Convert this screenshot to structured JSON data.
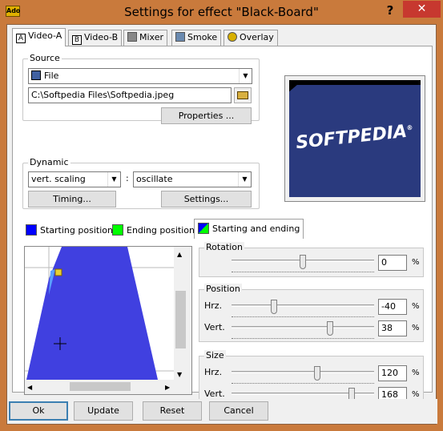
{
  "window": {
    "title": "Settings for effect \"Black-Board\"",
    "app_icon_text": "Ado",
    "help": "?",
    "close": "✕"
  },
  "tabs": [
    {
      "icon": "A",
      "label": "Video-A"
    },
    {
      "icon": "B",
      "label": "Video-B"
    },
    {
      "icon": "",
      "label": "Mixer"
    },
    {
      "icon": "",
      "label": "Smoke"
    },
    {
      "icon": "",
      "label": "Overlay"
    }
  ],
  "source": {
    "label": "Source",
    "type_value": "File",
    "path_value": "C:\\Softpedia Files\\Softpedia.jpeg",
    "properties_button": "Properties ..."
  },
  "dynamic": {
    "label": "Dynamic",
    "mode_value": "vert. scaling",
    "separator": ":",
    "motion_value": "oscillate",
    "timing_button": "Timing...",
    "settings_button": "Settings..."
  },
  "preview": {
    "text": "SOFTPEDIA",
    "mark": "®"
  },
  "position_tabs": [
    {
      "label": "Starting position",
      "color": "#0000ff"
    },
    {
      "label": "Ending position",
      "color": "#00ff00"
    },
    {
      "label": "Starting and ending"
    }
  ],
  "rotation": {
    "label": "Rotation",
    "value": "0",
    "unit": "%",
    "slider_fraction": 0.5
  },
  "position": {
    "label": "Position",
    "hrz_label": "Hrz.",
    "hrz_value": "-40",
    "hrz_unit": "%",
    "hrz_fraction": 0.3,
    "vert_label": "Vert.",
    "vert_value": "38",
    "vert_unit": "%",
    "vert_fraction": 0.69
  },
  "size": {
    "label": "Size",
    "hrz_label": "Hrz.",
    "hrz_value": "120",
    "hrz_unit": "%",
    "hrz_fraction": 0.6,
    "vert_label": "Vert.",
    "vert_value": "168",
    "vert_unit": "%",
    "vert_fraction": 0.84
  },
  "buttons": {
    "ok": "Ok",
    "update": "Update",
    "reset": "Reset",
    "cancel": "Cancel"
  },
  "colors": {
    "shape_blue": "#4040e0",
    "preview_bg": "#2a3a7e",
    "title_bar": "#c97a3c"
  }
}
